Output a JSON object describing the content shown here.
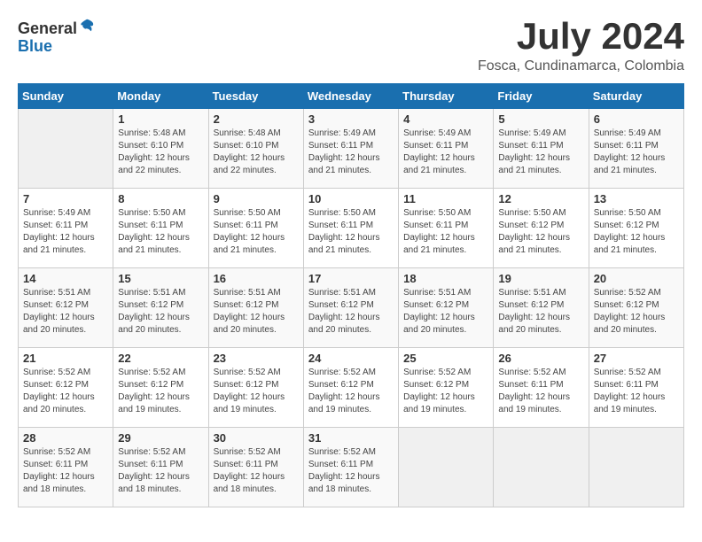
{
  "header": {
    "logo_line1": "General",
    "logo_line2": "Blue",
    "month_year": "July 2024",
    "location": "Fosca, Cundinamarca, Colombia"
  },
  "days_of_week": [
    "Sunday",
    "Monday",
    "Tuesday",
    "Wednesday",
    "Thursday",
    "Friday",
    "Saturday"
  ],
  "weeks": [
    [
      {
        "day": "",
        "info": ""
      },
      {
        "day": "1",
        "info": "Sunrise: 5:48 AM\nSunset: 6:10 PM\nDaylight: 12 hours\nand 22 minutes."
      },
      {
        "day": "2",
        "info": "Sunrise: 5:48 AM\nSunset: 6:10 PM\nDaylight: 12 hours\nand 22 minutes."
      },
      {
        "day": "3",
        "info": "Sunrise: 5:49 AM\nSunset: 6:11 PM\nDaylight: 12 hours\nand 21 minutes."
      },
      {
        "day": "4",
        "info": "Sunrise: 5:49 AM\nSunset: 6:11 PM\nDaylight: 12 hours\nand 21 minutes."
      },
      {
        "day": "5",
        "info": "Sunrise: 5:49 AM\nSunset: 6:11 PM\nDaylight: 12 hours\nand 21 minutes."
      },
      {
        "day": "6",
        "info": "Sunrise: 5:49 AM\nSunset: 6:11 PM\nDaylight: 12 hours\nand 21 minutes."
      }
    ],
    [
      {
        "day": "7",
        "info": "Sunrise: 5:49 AM\nSunset: 6:11 PM\nDaylight: 12 hours\nand 21 minutes."
      },
      {
        "day": "8",
        "info": "Sunrise: 5:50 AM\nSunset: 6:11 PM\nDaylight: 12 hours\nand 21 minutes."
      },
      {
        "day": "9",
        "info": "Sunrise: 5:50 AM\nSunset: 6:11 PM\nDaylight: 12 hours\nand 21 minutes."
      },
      {
        "day": "10",
        "info": "Sunrise: 5:50 AM\nSunset: 6:11 PM\nDaylight: 12 hours\nand 21 minutes."
      },
      {
        "day": "11",
        "info": "Sunrise: 5:50 AM\nSunset: 6:11 PM\nDaylight: 12 hours\nand 21 minutes."
      },
      {
        "day": "12",
        "info": "Sunrise: 5:50 AM\nSunset: 6:12 PM\nDaylight: 12 hours\nand 21 minutes."
      },
      {
        "day": "13",
        "info": "Sunrise: 5:50 AM\nSunset: 6:12 PM\nDaylight: 12 hours\nand 21 minutes."
      }
    ],
    [
      {
        "day": "14",
        "info": "Sunrise: 5:51 AM\nSunset: 6:12 PM\nDaylight: 12 hours\nand 20 minutes."
      },
      {
        "day": "15",
        "info": "Sunrise: 5:51 AM\nSunset: 6:12 PM\nDaylight: 12 hours\nand 20 minutes."
      },
      {
        "day": "16",
        "info": "Sunrise: 5:51 AM\nSunset: 6:12 PM\nDaylight: 12 hours\nand 20 minutes."
      },
      {
        "day": "17",
        "info": "Sunrise: 5:51 AM\nSunset: 6:12 PM\nDaylight: 12 hours\nand 20 minutes."
      },
      {
        "day": "18",
        "info": "Sunrise: 5:51 AM\nSunset: 6:12 PM\nDaylight: 12 hours\nand 20 minutes."
      },
      {
        "day": "19",
        "info": "Sunrise: 5:51 AM\nSunset: 6:12 PM\nDaylight: 12 hours\nand 20 minutes."
      },
      {
        "day": "20",
        "info": "Sunrise: 5:52 AM\nSunset: 6:12 PM\nDaylight: 12 hours\nand 20 minutes."
      }
    ],
    [
      {
        "day": "21",
        "info": "Sunrise: 5:52 AM\nSunset: 6:12 PM\nDaylight: 12 hours\nand 20 minutes."
      },
      {
        "day": "22",
        "info": "Sunrise: 5:52 AM\nSunset: 6:12 PM\nDaylight: 12 hours\nand 19 minutes."
      },
      {
        "day": "23",
        "info": "Sunrise: 5:52 AM\nSunset: 6:12 PM\nDaylight: 12 hours\nand 19 minutes."
      },
      {
        "day": "24",
        "info": "Sunrise: 5:52 AM\nSunset: 6:12 PM\nDaylight: 12 hours\nand 19 minutes."
      },
      {
        "day": "25",
        "info": "Sunrise: 5:52 AM\nSunset: 6:12 PM\nDaylight: 12 hours\nand 19 minutes."
      },
      {
        "day": "26",
        "info": "Sunrise: 5:52 AM\nSunset: 6:11 PM\nDaylight: 12 hours\nand 19 minutes."
      },
      {
        "day": "27",
        "info": "Sunrise: 5:52 AM\nSunset: 6:11 PM\nDaylight: 12 hours\nand 19 minutes."
      }
    ],
    [
      {
        "day": "28",
        "info": "Sunrise: 5:52 AM\nSunset: 6:11 PM\nDaylight: 12 hours\nand 18 minutes."
      },
      {
        "day": "29",
        "info": "Sunrise: 5:52 AM\nSunset: 6:11 PM\nDaylight: 12 hours\nand 18 minutes."
      },
      {
        "day": "30",
        "info": "Sunrise: 5:52 AM\nSunset: 6:11 PM\nDaylight: 12 hours\nand 18 minutes."
      },
      {
        "day": "31",
        "info": "Sunrise: 5:52 AM\nSunset: 6:11 PM\nDaylight: 12 hours\nand 18 minutes."
      },
      {
        "day": "",
        "info": ""
      },
      {
        "day": "",
        "info": ""
      },
      {
        "day": "",
        "info": ""
      }
    ]
  ]
}
